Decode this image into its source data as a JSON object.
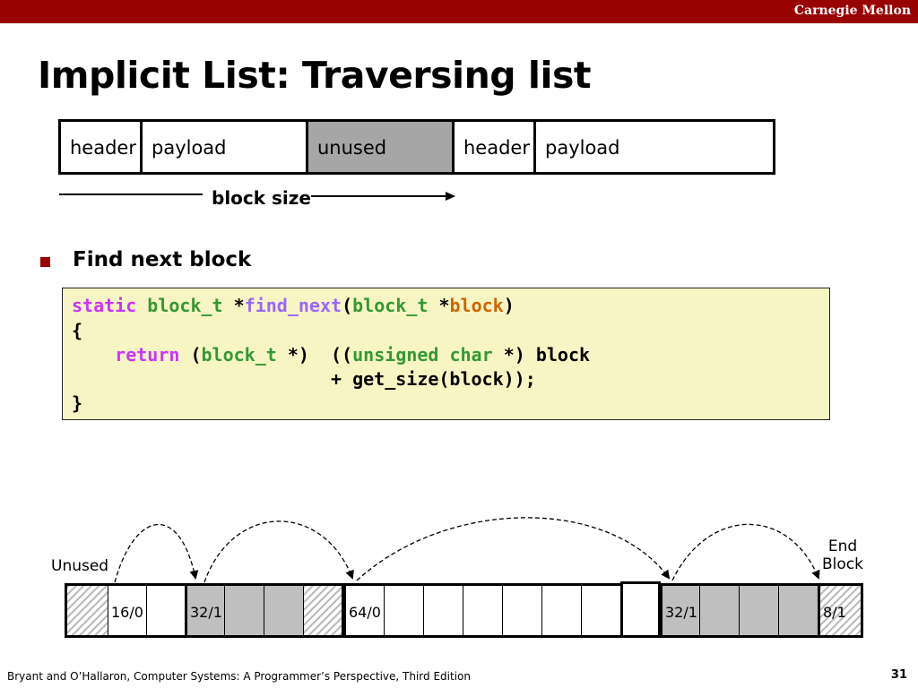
{
  "header": {
    "brand": "Carnegie Mellon"
  },
  "title": "Implicit List: Traversing list",
  "blocks": [
    {
      "label": "header",
      "shade": "white"
    },
    {
      "label": "payload",
      "shade": "white"
    },
    {
      "label": "unused",
      "shade": "gray"
    },
    {
      "label": "header",
      "shade": "white"
    },
    {
      "label": "payload",
      "shade": "white"
    }
  ],
  "block_size_label": "block size",
  "bullet": "Find next block",
  "code": {
    "kw_static": "static",
    "ty_block_t": "block_t",
    "star": " *",
    "fn_find_next": "find_next",
    "open_paren": "(",
    "star2": " *",
    "ar_block": "block",
    "close_paren": ")",
    "brace_open": "{",
    "kw_return": "return",
    "cast_open": " (",
    "cast_close": " *)  ((",
    "ty_unsigned_char": "unsigned char",
    "cast_tail": " *) block",
    "line4": "+ get_size(block));",
    "brace_close": "}",
    "colors": {
      "keyword": "#cc33ff",
      "type": "#339933",
      "function": "#9966ff",
      "argument": "#cc6600"
    }
  },
  "heap": {
    "unused_label": "Unused",
    "end_block_label_line1": "End",
    "end_block_label_line2": "Block",
    "cells": [
      {
        "label": "",
        "fill": "hatched"
      },
      {
        "label": "16/0",
        "fill": "white"
      },
      {
        "label": "",
        "fill": "white"
      },
      {
        "label": "32/1",
        "fill": "gray"
      },
      {
        "label": "",
        "fill": "gray"
      },
      {
        "label": "",
        "fill": "gray"
      },
      {
        "label": "",
        "fill": "hatched"
      },
      {
        "label": "64/0",
        "fill": "white"
      },
      {
        "label": "",
        "fill": "white"
      },
      {
        "label": "",
        "fill": "white"
      },
      {
        "label": "",
        "fill": "white"
      },
      {
        "label": "",
        "fill": "white"
      },
      {
        "label": "",
        "fill": "white"
      },
      {
        "label": "",
        "fill": "white"
      },
      {
        "label": "",
        "fill": "white"
      },
      {
        "label": "32/1",
        "fill": "gray"
      },
      {
        "label": "",
        "fill": "gray"
      },
      {
        "label": "",
        "fill": "gray"
      },
      {
        "label": "",
        "fill": "gray"
      },
      {
        "label": "8/1",
        "fill": "hatched"
      }
    ]
  },
  "footer": "Bryant and O’Hallaron, Computer Systems: A Programmer’s Perspective, Third Edition",
  "page_number": "31",
  "colors": {
    "brand_bar": "#990000",
    "code_bg": "#f8f5c4",
    "unused_fill": "#a6a6a6"
  }
}
